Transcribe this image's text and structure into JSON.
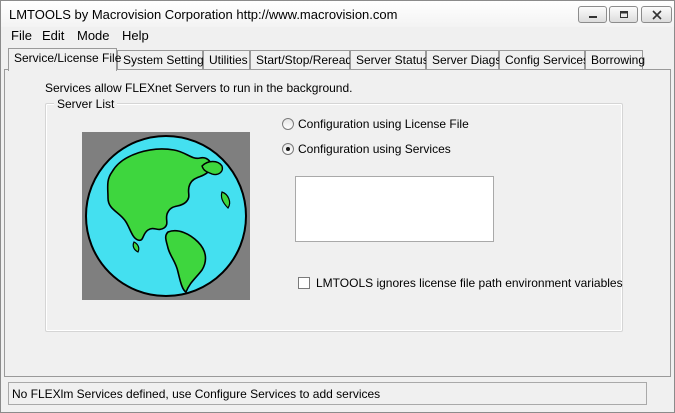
{
  "window": {
    "title": "LMTOOLS by Macrovision Corporation http://www.macrovision.com"
  },
  "menu": [
    "File",
    "Edit",
    "Mode",
    "Help"
  ],
  "tabs": [
    "Service/License File",
    "System Settings",
    "Utilities",
    "Start/Stop/Reread",
    "Server Status",
    "Server Diags",
    "Config Services",
    "Borrowing"
  ],
  "active_tab": "Service/License File",
  "panel": {
    "intro": "Services allow FLEXnet Servers to run in the background.",
    "group_label": "Server List",
    "radio_license": "Configuration using License File",
    "radio_services": "Configuration using Services",
    "selected_radio": "Configuration using Services",
    "checkbox_label": "LMTOOLS ignores license file path environment variables",
    "checkbox_checked": false
  },
  "status": "No FLEXlm Services defined, use Configure Services to add services"
}
